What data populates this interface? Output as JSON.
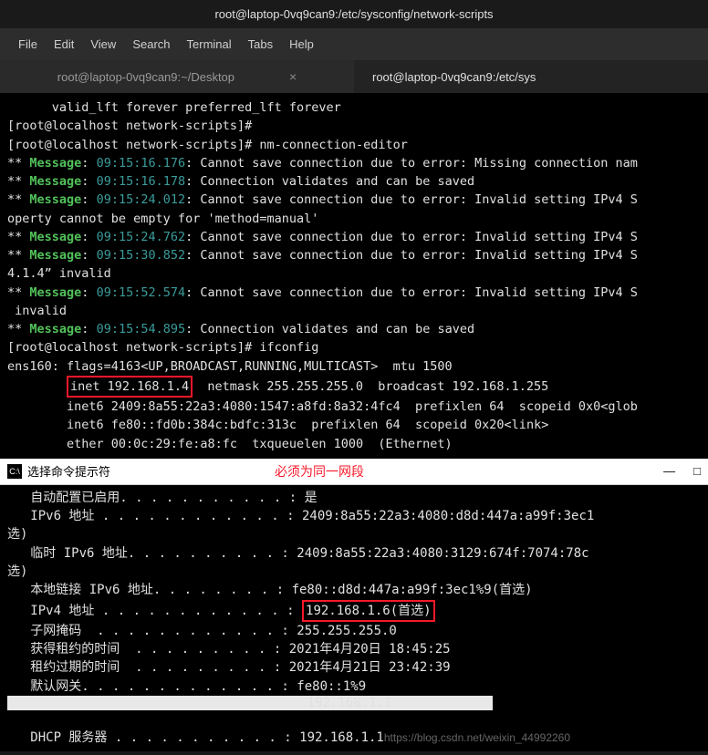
{
  "window": {
    "title": "root@laptop-0vq9can9:/etc/sysconfig/network-scripts"
  },
  "menu": {
    "file": "File",
    "edit": "Edit",
    "view": "View",
    "search": "Search",
    "terminal": "Terminal",
    "tabs": "Tabs",
    "help": "Help"
  },
  "tabs": {
    "tab1": "root@laptop-0vq9can9:~/Desktop",
    "tab1_close": "×",
    "tab2": "root@laptop-0vq9can9:/etc/sys"
  },
  "term": {
    "l1": "      valid_lft forever preferred_lft forever",
    "l2": "[root@localhost network-scripts]#",
    "l3a": "[root@localhost network-scripts]# ",
    "l3b": "nm-connection-editor",
    "l4a": "** ",
    "l4b": "Message",
    "l4c": ": ",
    "l4d": "09:15:16.176",
    "l4e": ": Cannot save connection due to error: Missing connection nam",
    "l5a": "** ",
    "l5b": "Message",
    "l5c": ": ",
    "l5d": "09:15:16.178",
    "l5e": ": Connection validates and can be saved",
    "l6a": "** ",
    "l6b": "Message",
    "l6c": ": ",
    "l6d": "09:15:24.012",
    "l6e": ": Cannot save connection due to error: Invalid setting IPv4 S",
    "l7": "operty cannot be empty for 'method=manual'",
    "l8a": "** ",
    "l8b": "Message",
    "l8c": ": ",
    "l8d": "09:15:24.762",
    "l8e": ": Cannot save connection due to error: Invalid setting IPv4 S",
    "l9a": "** ",
    "l9b": "Message",
    "l9c": ": ",
    "l9d": "09:15:30.852",
    "l9e": ": Cannot save connection due to error: Invalid setting IPv4 S",
    "l10": "4.1.4” invalid",
    "l11a": "** ",
    "l11b": "Message",
    "l11c": ": ",
    "l11d": "09:15:52.574",
    "l11e": ": Cannot save connection due to error: Invalid setting IPv4 S",
    "l12": " invalid",
    "l13a": "** ",
    "l13b": "Message",
    "l13c": ": ",
    "l13d": "09:15:54.895",
    "l13e": ": Connection validates and can be saved",
    "l14a": "[root@localhost network-scripts]# ",
    "l14b": "ifconfig",
    "l15": "ens160: flags=4163<UP,BROADCAST,RUNNING,MULTICAST>  mtu 1500",
    "l16a": "        ",
    "l16b": "inet 192.168.1.4",
    "l16c": "  netmask 255.255.255.0  broadcast 192.168.1.255",
    "l17": "        inet6 2409:8a55:22a3:4080:1547:a8fd:8a32:4fc4  prefixlen 64  scopeid 0x0<glob",
    "l18": "        inet6 fe80::fd0b:384c:bdfc:313c  prefixlen 64  scopeid 0x20<link>",
    "l19": "        ether 00:0c:29:fe:a8:fc  txqueuelen 1000  (Ethernet)"
  },
  "cmd": {
    "icon": "C:\\",
    "title": "选择命令提示符",
    "annotation": "必须为同一网段",
    "min": "—",
    "max": "□",
    "body1": "   自动配置已启用. . . . . . . . . . . : 是",
    "body2": "   IPv6 地址 . . . . . . . . . . . . : 2409:8a55:22a3:4080:d8d:447a:a99f:3ec1",
    "body3": "选)",
    "body4": "   临时 IPv6 地址. . . . . . . . . . : 2409:8a55:22a3:4080:3129:674f:7074:78c",
    "body5": "选)",
    "body6": "   本地链接 IPv6 地址. . . . . . . . : fe80::d8d:447a:a99f:3ec1%9(首选)",
    "body7a": "   IPv4 地址 . . . . . . . . . . . . : ",
    "body7b": "192.168.1.6(首选)",
    "body8": "   子网掩码  . . . . . . . . . . . . : 255.255.255.0",
    "body9": "   获得租约的时间  . . . . . . . . . : 2021年4月20日 18:45:25",
    "body10": "   租约过期的时间  . . . . . . . . . : 2021年4月21日 23:42:39",
    "body11": "   默认网关. . . . . . . . . . . . . : fe80::1%9",
    "body12": "                                       192.168.1.1",
    "body13a": "   DHCP 服务器 . . . . . . . . . . . : 192.168.1.1",
    "watermark": "https://blog.csdn.net/weixin_44992260"
  }
}
